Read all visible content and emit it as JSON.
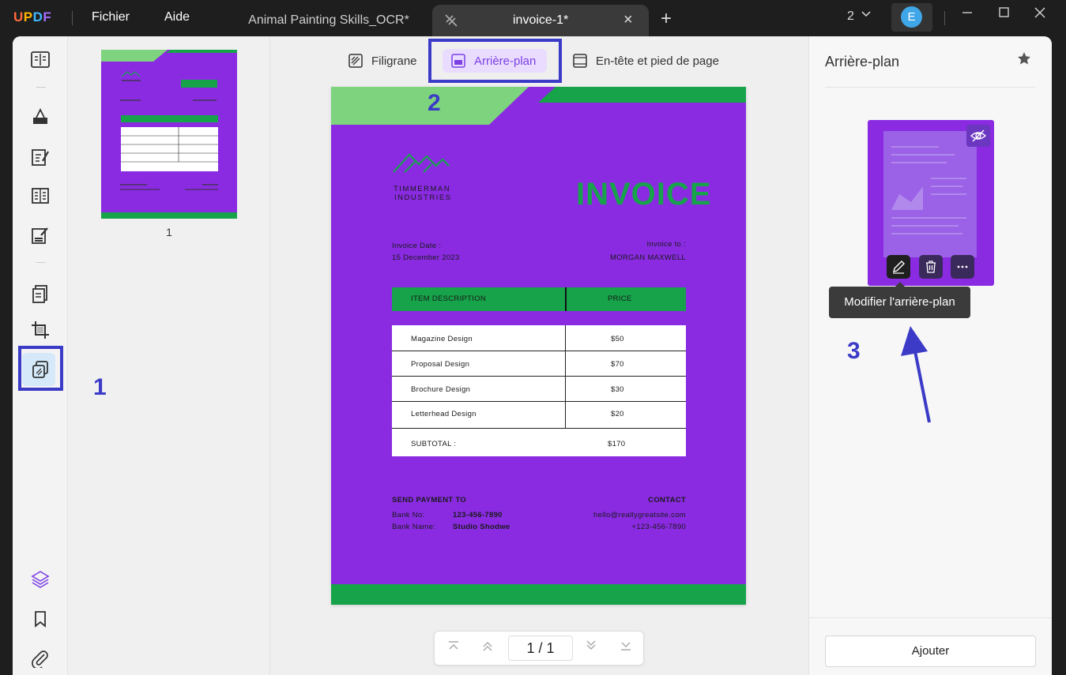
{
  "titlebar": {
    "logo_letters": [
      "U",
      "P",
      "D",
      "F"
    ],
    "menu": [
      "Fichier",
      "Aide"
    ],
    "tabs": [
      {
        "label": "Animal Painting Skills_OCR*",
        "active": false
      },
      {
        "label": "invoice-1*",
        "active": true
      }
    ],
    "window_count": "2",
    "user_initial": "E"
  },
  "sidebar": {
    "tools": [
      "reader-icon",
      "comment-icon",
      "edit-icon",
      "organize-icon",
      "fill-sign-icon",
      "convert-icon",
      "crop-icon",
      "page-tools-icon",
      "layers-icon",
      "bookmark-icon",
      "attachment-icon"
    ]
  },
  "thumbnails": {
    "items": [
      {
        "page": "1"
      }
    ]
  },
  "toolbar": {
    "watermark_label": "Filigrane",
    "background_label": "Arrière-plan",
    "header_footer_label": "En-tête et pied de page"
  },
  "invoice": {
    "company_line1": "TIMMERMAN",
    "company_line2": "INDUSTRIES",
    "title": "INVOICE",
    "date_label": "Invoice Date :",
    "date_value": "15 December 2023",
    "to_label": "Invoice to :",
    "to_value": "MORGAN MAXWELL",
    "col_desc": "ITEM DESCRIPTION",
    "col_price": "PRICE",
    "rows": [
      {
        "desc": "Magazine Design",
        "price": "$50"
      },
      {
        "desc": "Proposal Design",
        "price": "$70"
      },
      {
        "desc": "Brochure Design",
        "price": "$30"
      },
      {
        "desc": "Letterhead Design",
        "price": "$20"
      }
    ],
    "subtotal_label": "SUBTOTAL :",
    "subtotal_value": "$170",
    "send_label": "SEND PAYMENT TO",
    "bank_no_label": "Bank No:",
    "bank_no_value": "123-456-7890",
    "bank_name_label": "Bank Name:",
    "bank_name_value": "Studio Shodwe",
    "contact_label": "CONTACT",
    "contact_email": "hello@reallygreatsite.com",
    "contact_phone": "+123-456-7890",
    "colors": {
      "background": "#8a2be2",
      "accent": "#16a34a",
      "light_accent": "#7ed37e"
    }
  },
  "pager": {
    "current": "1",
    "separator": "/",
    "total": "1"
  },
  "rightpanel": {
    "title": "Arrière-plan",
    "tooltip": "Modifier l'arrière-plan",
    "add_label": "Ajouter"
  },
  "annotations": {
    "labels": [
      "1",
      "2",
      "3"
    ],
    "color": "#3b3bc8"
  }
}
